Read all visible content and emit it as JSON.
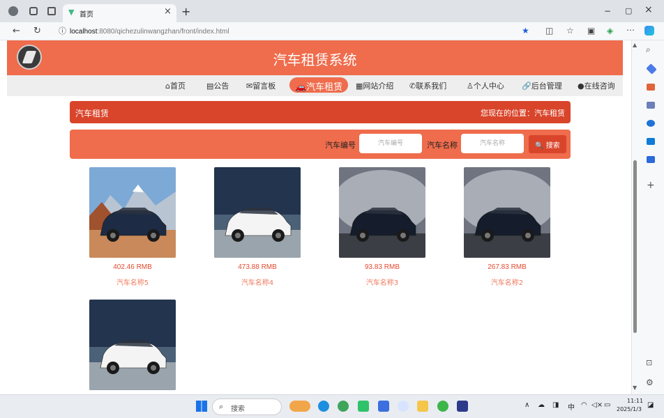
{
  "browser": {
    "tab_title": "首页",
    "tab_close": "×",
    "new_tab": "+",
    "url_host": "localhost",
    "url_rest": ":8080/qichezulinwangzhan/front/index.html",
    "win_min": "−",
    "win_max": "▢",
    "win_close": "×"
  },
  "site": {
    "title": "汽车租赁系统",
    "nav": [
      {
        "label": "⌂首页"
      },
      {
        "label": "▤公告"
      },
      {
        "label": "✉留言板"
      },
      {
        "label": "🚗汽车租赁"
      },
      {
        "label": "▦网站介绍"
      },
      {
        "label": "✆联系我们"
      },
      {
        "label": "♙个人中心"
      },
      {
        "label": "🔗后台管理"
      },
      {
        "label": "●在线咨询"
      }
    ],
    "breadcrumb": {
      "title": "汽车租赁",
      "location": "您现在的位置：汽车租赁"
    },
    "search": {
      "code_label": "汽车编号",
      "code_placeholder": "汽车编号",
      "name_label": "汽车名称",
      "name_placeholder": "汽车名称",
      "button": "🔍 搜索"
    },
    "cars": [
      {
        "price": "402.46 RMB",
        "name": "汽车名称5",
        "scene": "desert",
        "car_color": "#1d2b44"
      },
      {
        "price": "473.88 RMB",
        "name": "汽车名称4",
        "scene": "sea",
        "car_color": "#f4f4f4"
      },
      {
        "price": "93.83 RMB",
        "name": "汽车名称3",
        "scene": "studio",
        "car_color": "#151c2b"
      },
      {
        "price": "267.83 RMB",
        "name": "汽车名称2",
        "scene": "studio",
        "car_color": "#151c2b"
      },
      {
        "price": "",
        "name": "",
        "scene": "sea",
        "car_color": "#f4f4f4"
      }
    ]
  },
  "taskbar": {
    "search_label": "搜索",
    "ime": "中",
    "time": "11:11",
    "date": "2025/1/3"
  },
  "colors": {
    "primary": "#ef6c4c",
    "dark": "#d9452b",
    "price": "#e24a2e"
  }
}
